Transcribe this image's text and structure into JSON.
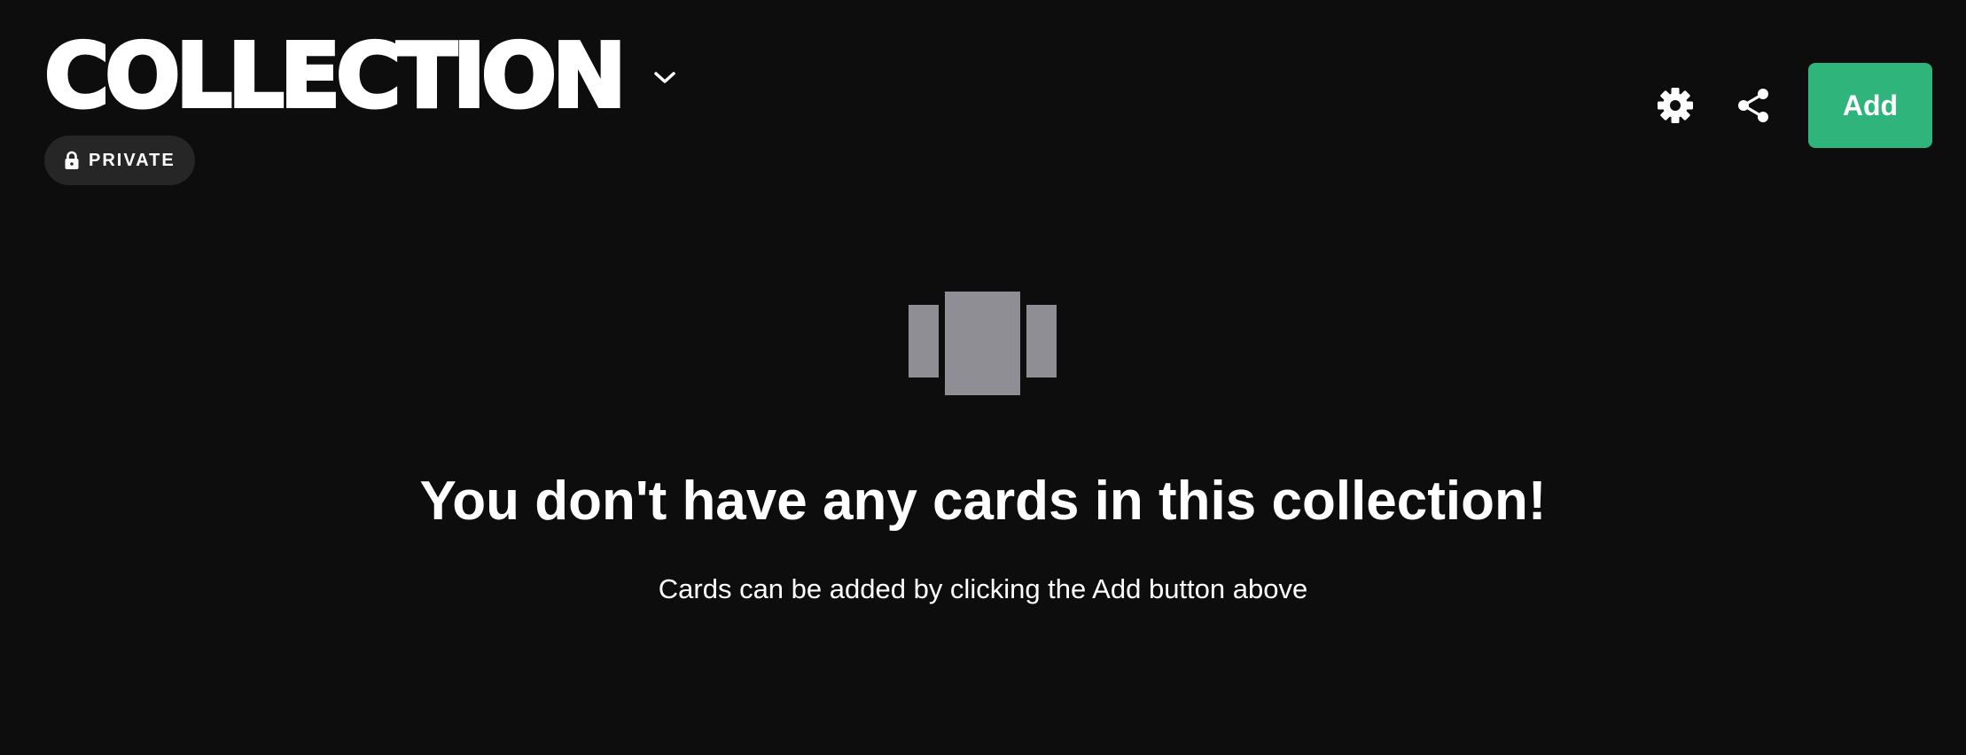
{
  "header": {
    "title": "COLLECTION",
    "title_menu_icon": "chevron-down-icon",
    "privacy_icon": "lock-icon",
    "privacy_label": "PRIVATE"
  },
  "toolbar": {
    "settings_icon": "gear-icon",
    "share_icon": "share-icon",
    "add_label": "Add",
    "add_color": "#2fb47c"
  },
  "empty_state": {
    "illustration_icon": "cards-icon",
    "heading": "You don't have any cards in this collection!",
    "subtext": "Cards can be added by clicking the Add button above"
  },
  "colors": {
    "background": "#0d0d0d",
    "badge_background": "#262626",
    "illustration": "#8e8e94",
    "text": "#ffffff"
  }
}
